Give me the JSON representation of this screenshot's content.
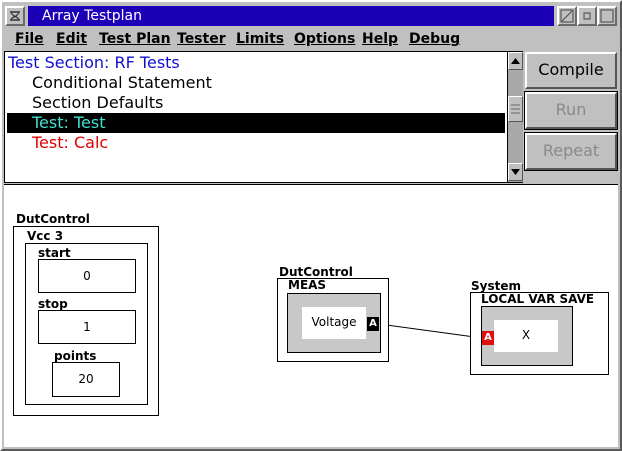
{
  "window": {
    "title": "Array Testplan"
  },
  "menu": [
    "File",
    "Edit",
    "Test Plan",
    "Tester",
    "Limits",
    "Options",
    "Help",
    "Debug"
  ],
  "tree": {
    "items": [
      {
        "label": "Test Section: RF Tests",
        "color": "#1010d0"
      },
      {
        "label": "Conditional Statement",
        "color": "#000000"
      },
      {
        "label": "Section Defaults",
        "color": "#000000"
      },
      {
        "label": "Test: Test",
        "color": "#40e0d0",
        "selected": true
      },
      {
        "label": "Test: Calc",
        "color": "#e00000"
      }
    ]
  },
  "buttons": {
    "compile": "Compile",
    "run": "Run",
    "repeat": "Repeat"
  },
  "canvas": {
    "block1": {
      "outer_label": "DutControl",
      "inner_label": "Vcc 3",
      "start_label": "start",
      "start_value": "0",
      "stop_label": "stop",
      "stop_value": "1",
      "points_label": "points",
      "points_value": "20"
    },
    "block2": {
      "outer_label": "DutControl",
      "inner_label": "MEAS",
      "value_label": "Voltage",
      "port_label": "A",
      "port_color": "#000000"
    },
    "block3": {
      "outer_label": "System",
      "inner_label": "LOCAL VAR SAVE",
      "value_label": "X",
      "port_label": "A",
      "port_color": "#e01010"
    }
  }
}
